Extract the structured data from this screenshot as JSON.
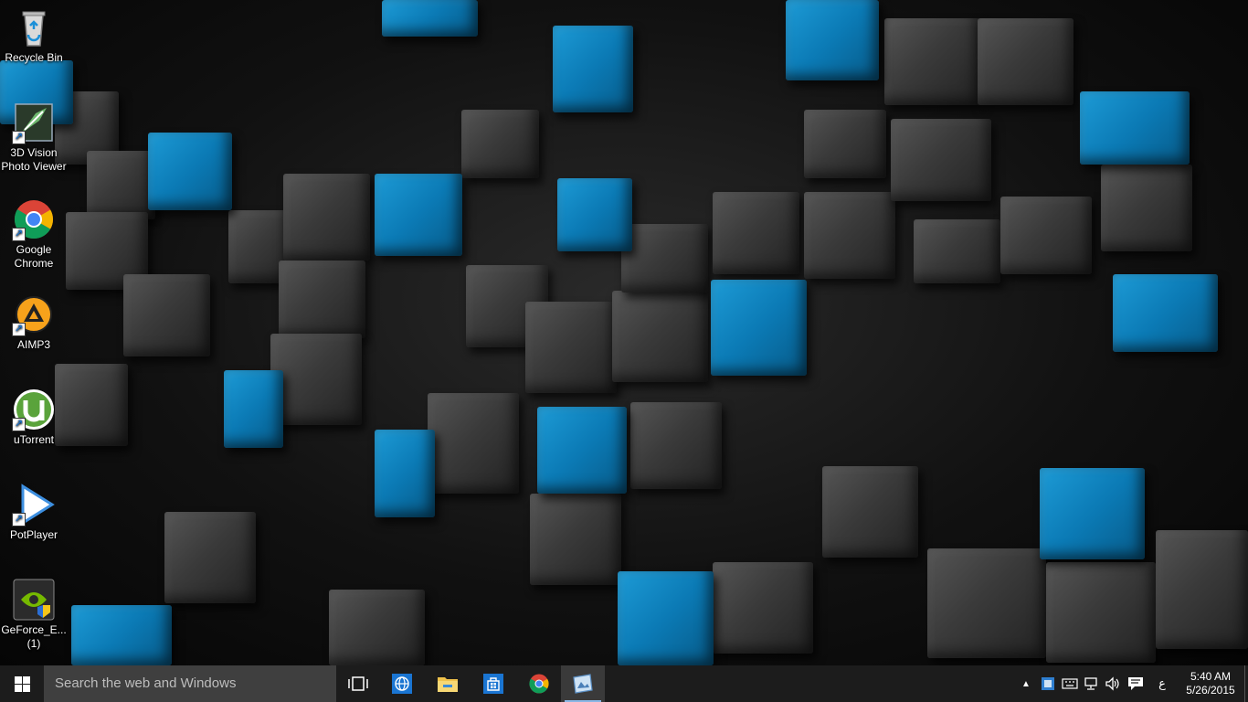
{
  "desktop": {
    "icons": [
      {
        "label": "Recycle Bin",
        "icon": "recycle-bin-icon"
      },
      {
        "label": "3D Vision Photo Viewer",
        "icon": "3d-vision-icon"
      },
      {
        "label": "Google Chrome",
        "icon": "chrome-icon"
      },
      {
        "label": "AIMP3",
        "icon": "aimp-icon"
      },
      {
        "label": "uTorrent",
        "icon": "utorrent-icon"
      },
      {
        "label": "PotPlayer",
        "icon": "potplayer-icon"
      },
      {
        "label": "GeForce_E... (1)",
        "icon": "geforce-experience-icon"
      }
    ]
  },
  "taskbar": {
    "search_placeholder": "Search the web and Windows",
    "pinned_apps": [
      {
        "name": "Internet Explorer",
        "icon": "globe-icon"
      },
      {
        "name": "File Explorer",
        "icon": "folder-icon"
      },
      {
        "name": "Store",
        "icon": "store-icon"
      },
      {
        "name": "Google Chrome",
        "icon": "chrome-icon"
      },
      {
        "name": "Photo Viewer",
        "icon": "photo-viewer-icon"
      }
    ],
    "tray": {
      "input_language": "ع",
      "time": "5:40 AM",
      "date": "5/26/2015"
    }
  },
  "colors": {
    "taskbar_bg": "#1c1c1c",
    "search_bg": "#3f3f3f",
    "wallpaper_accent": "#0b7ab5"
  }
}
